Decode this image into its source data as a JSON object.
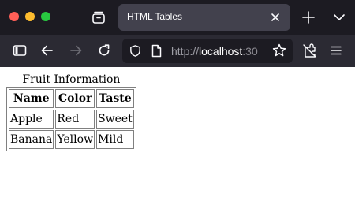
{
  "browser": {
    "tab": {
      "title": "HTML Tables"
    },
    "address": {
      "protocol": "http://",
      "host": "localhost",
      "port_partial": ":30"
    },
    "icons": {
      "tab_overview": "tab-overview-icon",
      "tab_close": "close-icon",
      "new_tab": "plus-icon",
      "list_tabs": "chevron-down-icon",
      "sidebar": "sidebar-icon",
      "back": "back-arrow-icon",
      "forward": "forward-arrow-icon",
      "reload": "reload-icon",
      "shield": "shield-icon",
      "page": "page-icon",
      "bookmark": "star-icon",
      "extensions": "extensions-icon",
      "menu": "hamburger-menu-icon"
    },
    "colors": {
      "tabbar_bg": "#1c1b22",
      "navbar_bg": "#2b2a33",
      "active_tab_bg": "#42414d",
      "traffic_close": "#ff5f57",
      "traffic_min": "#febc2e",
      "traffic_max": "#28c840"
    }
  },
  "page": {
    "caption": "Fruit Information",
    "table": {
      "headers": [
        "Name",
        "Color",
        "Taste"
      ],
      "rows": [
        [
          "Apple",
          "Red",
          "Sweet"
        ],
        [
          "Banana",
          "Yellow",
          "Mild"
        ]
      ]
    }
  }
}
